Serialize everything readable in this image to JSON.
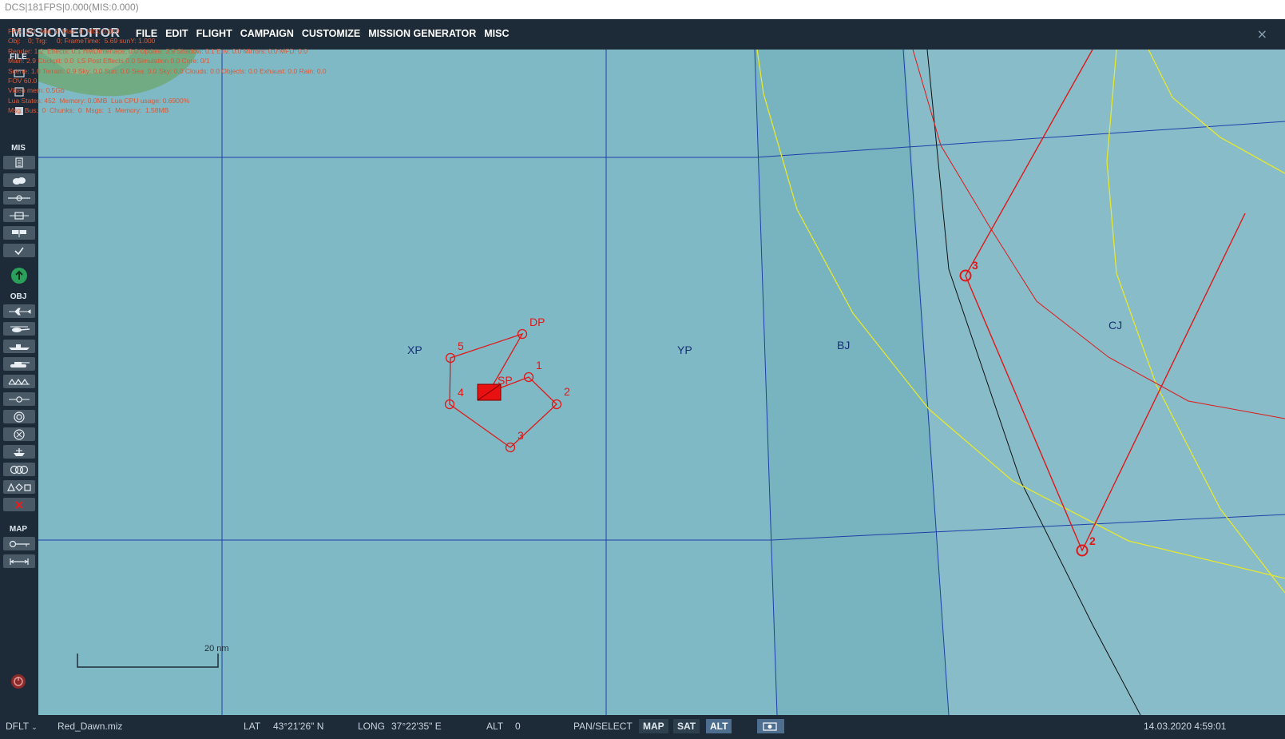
{
  "window_title": "DCS|181FPS|0.000(MIS:0.000)",
  "app_title": "MISSION EDITOR",
  "menu": [
    "FILE",
    "EDIT",
    "FLIGHT",
    "CAMPAIGN",
    "CUSTOMIZE",
    "MISSION GENERATOR",
    "MISC"
  ],
  "close_glyph": "×",
  "sidebar": {
    "file_label": "FILE",
    "mis_label": "MIS",
    "obj_label": "OBJ",
    "map_label": "MAP"
  },
  "debug_overlay": [
    "FPS: 181  Min: 0  Max: 0  MIS: 0.000",
    "Obj:    0; Trg:     0; FrameTime:  5.69 sunY: 1.000",
    "Render: 1.2  Effects: 0.1 HMDInterface: 0.0 Update: 3.9 Shadow: 0.1 Env: 0.0 Mirrors: 0.0 MFD: 0.0",
    "Main: 2.9 Cockpit: 0.0  LS Post Effects 0.0 Simulation 0.0 Core: 0/1",
    "Scene: 1.0 Terrain: 0.9 Sky: 0.0 Sun: 0.0 Sea: 0.0 Sky: 0.0 Clouds: 0.0 Objects: 0.0 Exhaust: 0.0 Rain: 0.0",
    "FOV 60.0",
    "Video mem: 0.5Gb",
    "Lua States: 452  Memory: 0.0MB  Lua CPU usage: 0.6900%",
    "Msg. Bus:  0  Chunks:  0  Msgs:  1  Memory:  1.58MB"
  ],
  "map": {
    "grid_labels": {
      "xp": "XP",
      "yp": "YP",
      "bj": "BJ",
      "cj": "CJ"
    },
    "route_small": {
      "waypoints": [
        "DP",
        "5",
        "4",
        "3",
        "2",
        "1"
      ],
      "start_label": "SP"
    },
    "route_large": {
      "waypoints": [
        "3",
        "2"
      ]
    },
    "scale_label": "20 nm",
    "colors": {
      "sea": "#7fb9c5",
      "grid": "#1f3fa8",
      "route": "#e01818",
      "border": "#e8e82a"
    }
  },
  "status": {
    "mode": "DFLT",
    "filename": "Red_Dawn.miz",
    "lat_label": "LAT",
    "lat_value": "43°21'26\" N",
    "long_label": "LONG",
    "long_value": "37°22'35\" E",
    "alt_label": "ALT",
    "alt_value": "0",
    "pan_select": "PAN/SELECT",
    "map_btn": "MAP",
    "sat_btn": "SAT",
    "alt_btn": "ALT",
    "datetime": "14.03.2020 4:59:01"
  }
}
